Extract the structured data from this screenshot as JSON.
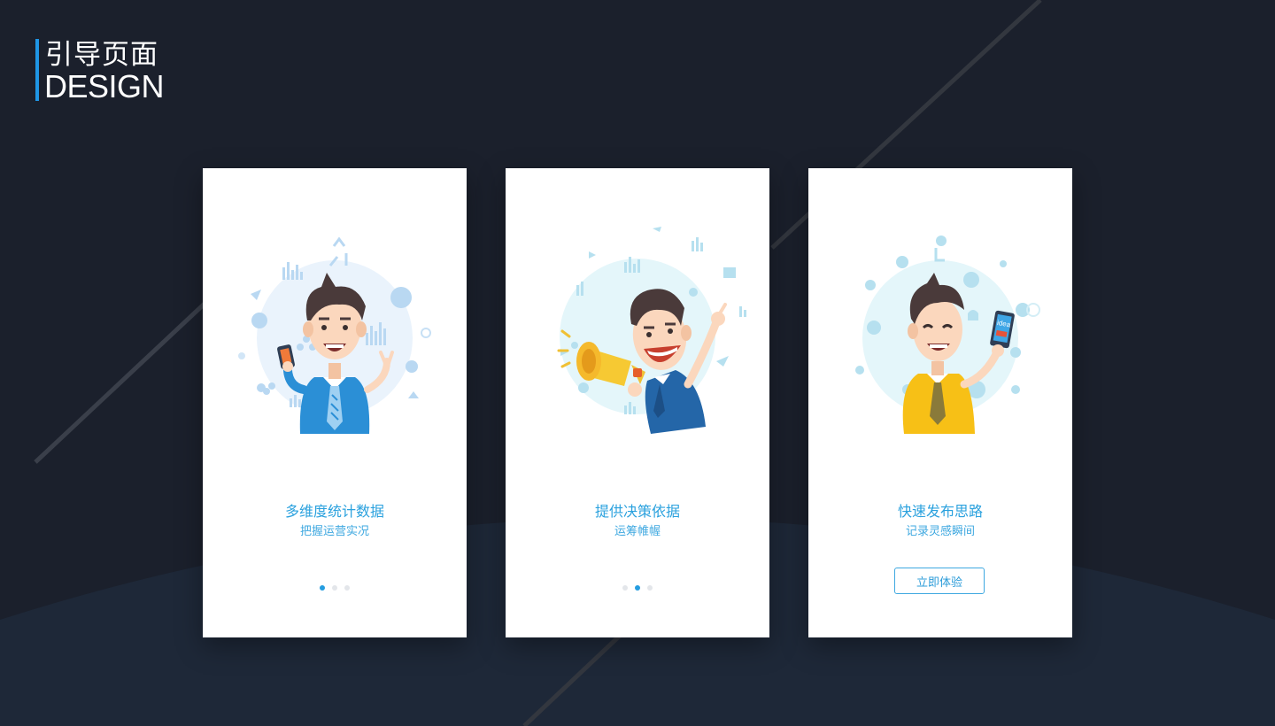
{
  "header": {
    "title_cn": "引导页面",
    "title_en": "DESIGN"
  },
  "colors": {
    "background": "#1b202c",
    "accent": "#1f96e6",
    "card": "#ffffff",
    "text_blue": "#2aa1de"
  },
  "screens": [
    {
      "title": "多维度统计数据",
      "subtitle": "把握运营实况",
      "illustration": "man-with-phone-charts-illustration",
      "pagination": {
        "total": 3,
        "active": 1
      }
    },
    {
      "title": "提供决策依据",
      "subtitle": "运筹帷幄",
      "illustration": "man-with-megaphone-illustration",
      "pagination": {
        "total": 3,
        "active": 2
      }
    },
    {
      "title": "快速发布思路",
      "subtitle": "记录灵感瞬间",
      "illustration": "man-with-idea-phone-illustration",
      "button_label": "立即体验",
      "phone_text": "idea"
    }
  ]
}
